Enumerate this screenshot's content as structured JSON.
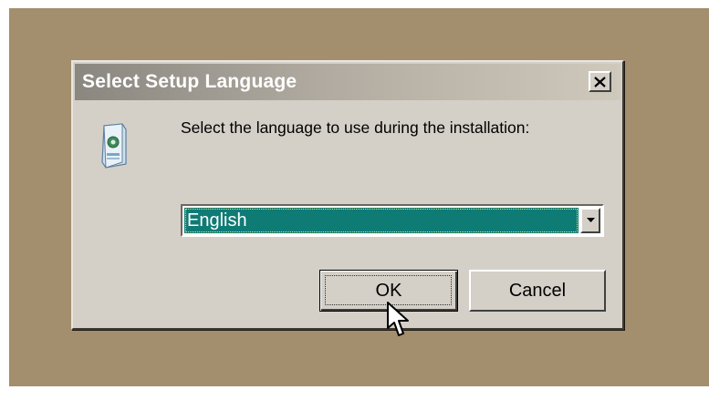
{
  "dialog": {
    "title": "Select Setup Language",
    "close_glyph": "close-icon",
    "icon": "setup-package-icon",
    "prompt": "Select the language to use during the installation:",
    "language_select": {
      "selected": "English",
      "arrow_icon": "chevron-down-icon"
    },
    "ok_label": "OK",
    "cancel_label": "Cancel"
  },
  "colors": {
    "desktop": "#a38e6d",
    "dialog_face": "#d4d0c8",
    "selection": "#0f7b75"
  },
  "cursor": "arrow-pointer-icon"
}
